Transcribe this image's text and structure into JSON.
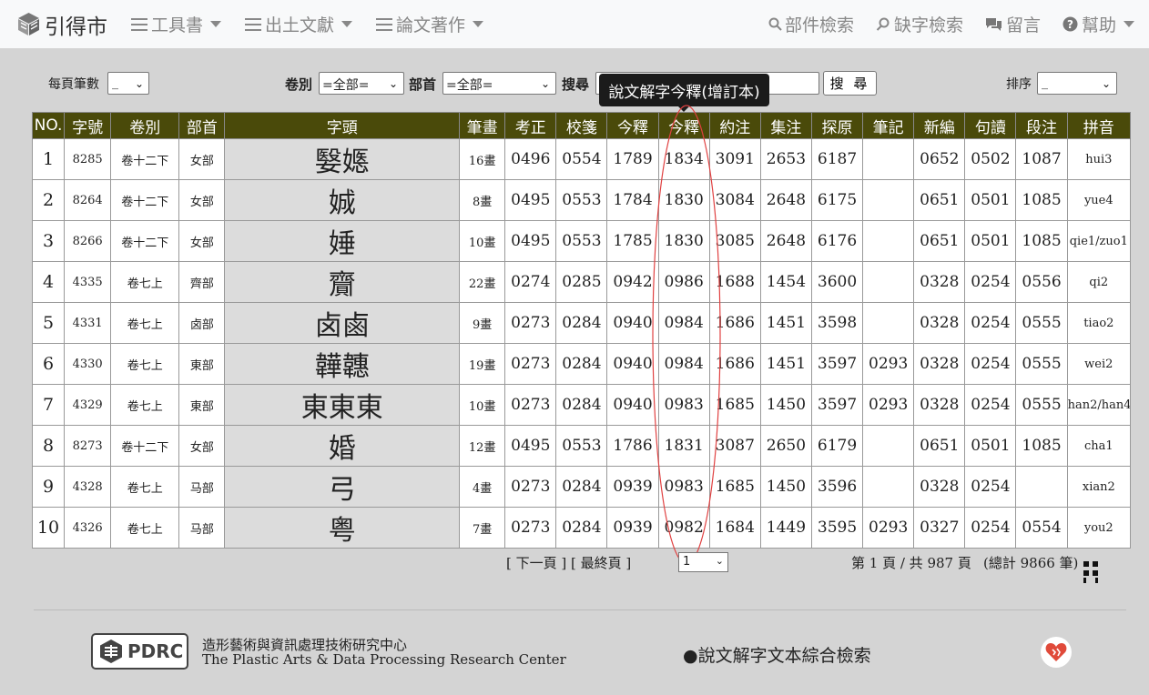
{
  "brand": {
    "title": "引得市"
  },
  "nav": {
    "left": [
      {
        "label": "工具書"
      },
      {
        "label": "出土文獻"
      },
      {
        "label": "論文著作"
      }
    ],
    "right": [
      {
        "label": "部件檢索",
        "icon": "search-icon"
      },
      {
        "label": "缺字檢索",
        "icon": "key-search-icon"
      },
      {
        "label": "留言",
        "icon": "comments-icon"
      },
      {
        "label": "幫助",
        "icon": "question-circle-icon"
      }
    ]
  },
  "filter": {
    "per_page_label": "每頁筆數",
    "per_page_value": "_",
    "volume_label": "卷別",
    "volume_value": "=全部=",
    "radical_label": "部首",
    "radical_value": "=全部=",
    "search_label": "搜尋",
    "search_button": "搜 尋",
    "sort_label": "排序",
    "sort_value": "_"
  },
  "tooltip": {
    "text": "說文解字今釋(增訂本)"
  },
  "table": {
    "headers": [
      "NO.",
      "字號",
      "卷別",
      "部首",
      "字頭",
      "筆畫",
      "考正",
      "校箋",
      "今釋",
      "今釋",
      "約注",
      "集注",
      "探原",
      "筆記",
      "新編",
      "句讀",
      "段注",
      "拼音"
    ],
    "rows": [
      [
        "1",
        "8285",
        "卷十二下",
        "女部",
        "嫛嫕",
        "16畫",
        "0496",
        "0554",
        "1789",
        "1834",
        "3091",
        "2653",
        "6187",
        "",
        "0652",
        "0502",
        "1087",
        "hui3"
      ],
      [
        "2",
        "8264",
        "卷十二下",
        "女部",
        "娍",
        "8畫",
        "0495",
        "0553",
        "1784",
        "1830",
        "3084",
        "2648",
        "6175",
        "",
        "0651",
        "0501",
        "1085",
        "yue4"
      ],
      [
        "3",
        "8266",
        "卷十二下",
        "女部",
        "娷",
        "10畫",
        "0495",
        "0553",
        "1785",
        "1830",
        "3085",
        "2648",
        "6176",
        "",
        "0651",
        "0501",
        "1085",
        "qie1/zuo1"
      ],
      [
        "4",
        "4335",
        "卷七上",
        "齊部",
        "齎",
        "22畫",
        "0274",
        "0285",
        "0942",
        "0986",
        "1688",
        "1454",
        "3600",
        "",
        "0328",
        "0254",
        "0556",
        "qi2"
      ],
      [
        "5",
        "4331",
        "卷七上",
        "卤部",
        "卤鹵",
        "9畫",
        "0273",
        "0284",
        "0940",
        "0984",
        "1686",
        "1451",
        "3598",
        "",
        "0328",
        "0254",
        "0555",
        "tiao2"
      ],
      [
        "6",
        "4330",
        "卷七上",
        "東部",
        "韡韢",
        "19畫",
        "0273",
        "0284",
        "0940",
        "0984",
        "1686",
        "1451",
        "3597",
        "0293",
        "0328",
        "0254",
        "0555",
        "wei2"
      ],
      [
        "7",
        "4329",
        "卷七上",
        "東部",
        "東東東",
        "10畫",
        "0273",
        "0284",
        "0940",
        "0983",
        "1685",
        "1450",
        "3597",
        "0293",
        "0328",
        "0254",
        "0555",
        "han2/han4"
      ],
      [
        "8",
        "8273",
        "卷十二下",
        "女部",
        "婚",
        "12畫",
        "0495",
        "0553",
        "1786",
        "1831",
        "3087",
        "2650",
        "6179",
        "",
        "0651",
        "0501",
        "1085",
        "cha1"
      ],
      [
        "9",
        "4328",
        "卷七上",
        "马部",
        "弓",
        "4畫",
        "0273",
        "0284",
        "0939",
        "0983",
        "1685",
        "1450",
        "3596",
        "",
        "0328",
        "0254",
        "",
        "xian2"
      ],
      [
        "10",
        "4326",
        "卷七上",
        "马部",
        "粤",
        "7畫",
        "0273",
        "0284",
        "0939",
        "0982",
        "1684",
        "1449",
        "3595",
        "0293",
        "0327",
        "0254",
        "0554",
        "you2"
      ]
    ]
  },
  "pager": {
    "next_label": "[ 下一頁 ]",
    "last_label": "[ 最終頁 ]",
    "current_page": "1",
    "summary": "第 1 頁 / 共 987 頁",
    "total": "(總計 9866 筆)"
  },
  "footer": {
    "logo_text": "PDRC",
    "org_zh": "造形藝術與資訊處理技術研究中心",
    "org_en": "The Plastic Arts & Data Processing Research Center",
    "link": "●說文解字文本綜合檢索"
  },
  "colors": {
    "header_bg": "#4a4a0a",
    "page_bg": "#d4d4d4",
    "oval": "#e04040"
  }
}
